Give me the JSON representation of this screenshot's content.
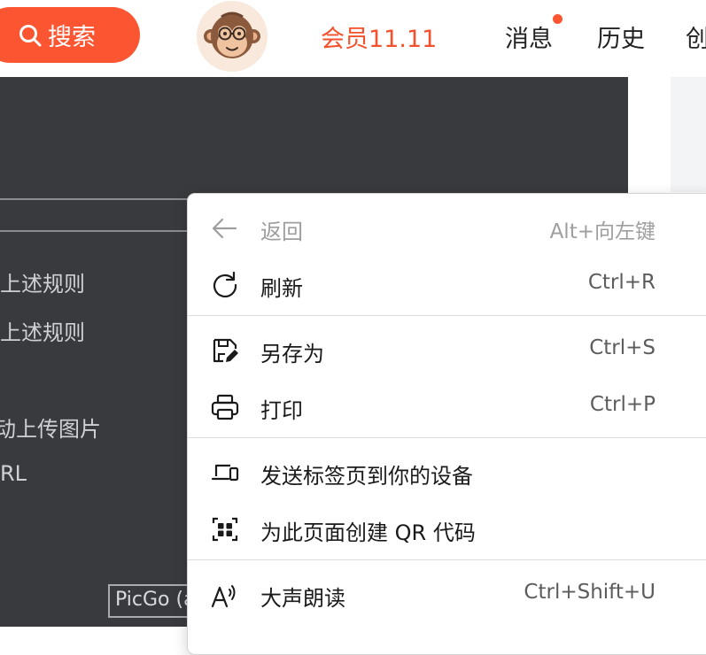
{
  "header": {
    "search_label": "搜索",
    "vip_label": "会员11.11",
    "messages_label": "消息",
    "history_label": "历史",
    "create_label": "创"
  },
  "background": {
    "lines": [
      "上述规则",
      "上述规则",
      "动上传图片",
      "RL"
    ],
    "picgo_label": "PicGo (a"
  },
  "menu": {
    "back": {
      "label": "返回",
      "shortcut": "Alt+向左键"
    },
    "refresh": {
      "label": "刷新",
      "shortcut": "Ctrl+R"
    },
    "save_as": {
      "label": "另存为",
      "shortcut": "Ctrl+S"
    },
    "print": {
      "label": "打印",
      "shortcut": "Ctrl+P"
    },
    "send_to_device": {
      "label": "发送标签页到你的设备"
    },
    "create_qr": {
      "label": "为此页面创建 QR 代码"
    },
    "read_aloud": {
      "label": "大声朗读",
      "shortcut": "Ctrl+Shift+U"
    }
  },
  "colors": {
    "brand": "#fc5531",
    "vip": "#f3502c",
    "panel": "#383a3e"
  },
  "icons": [
    "search-icon",
    "avatar-monkey",
    "back-arrow-icon",
    "refresh-icon",
    "save-as-icon",
    "print-icon",
    "send-device-icon",
    "qr-code-icon",
    "read-aloud-icon"
  ]
}
